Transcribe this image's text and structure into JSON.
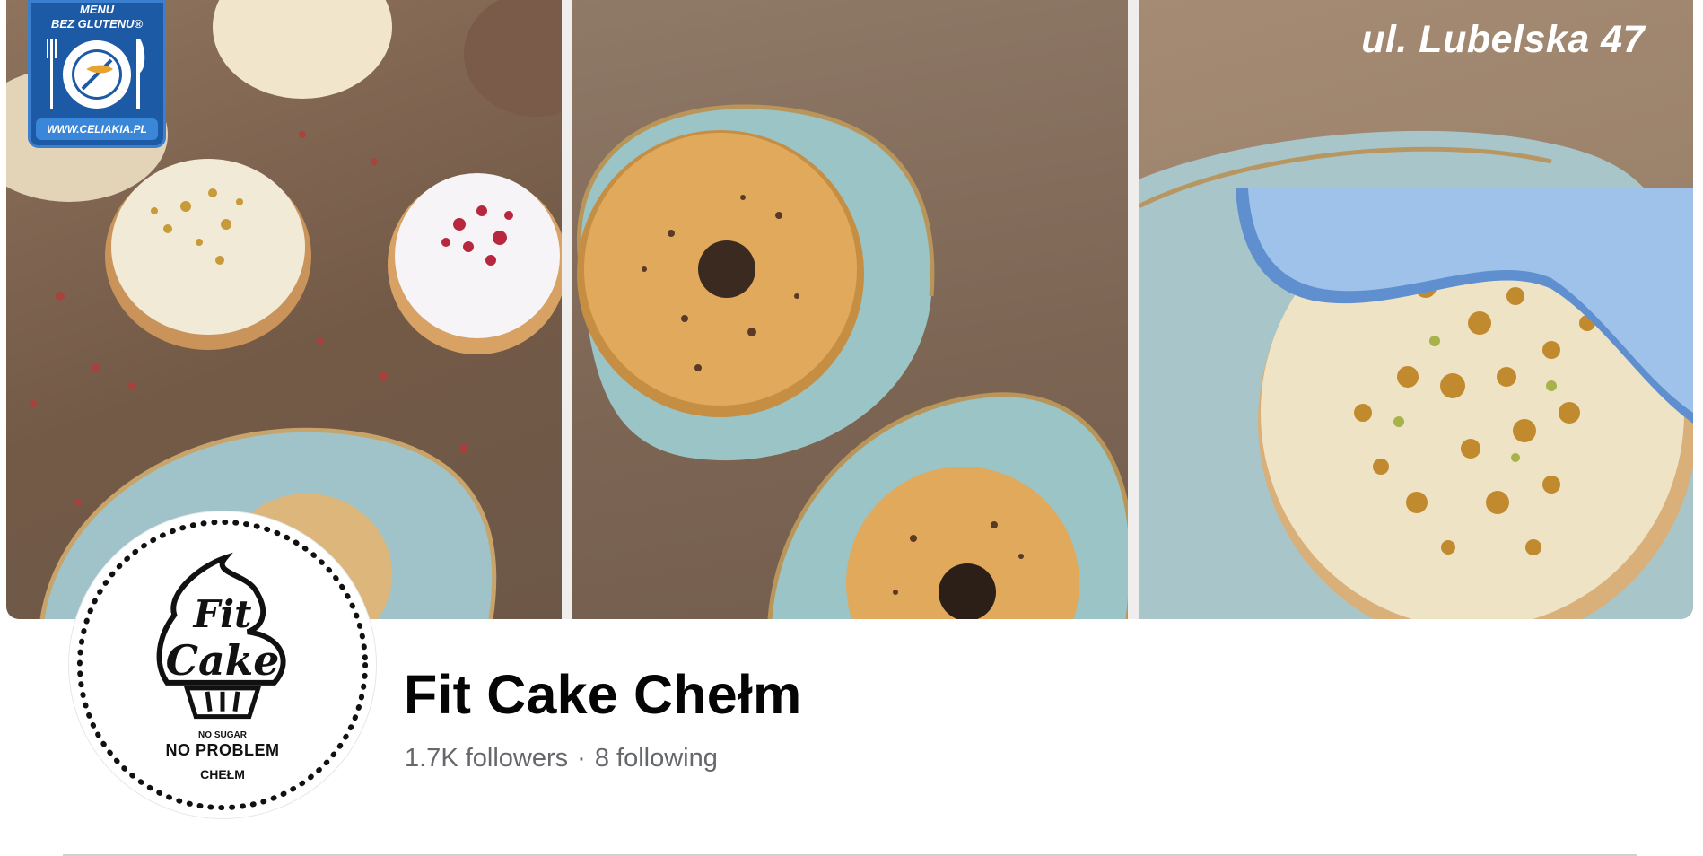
{
  "cover": {
    "badge": {
      "line1": "MENU",
      "line2": "BEZ GLUTENU®",
      "url": "WWW.CELIAKIA.PL"
    },
    "address": "ul. Lubelska 47"
  },
  "profile": {
    "avatar": {
      "logo_line1": "Fit",
      "logo_line2": "Cake",
      "sub": "NO SUGAR",
      "main": "NO PROBLEM",
      "city": "CHEŁM"
    },
    "name": "Fit Cake Chełm",
    "followers": "1.7K followers",
    "separator": "·",
    "following": "8 following"
  },
  "colors": {
    "badge_blue": "#1d5aa6",
    "banner_blue": "#8fb6e4",
    "text_primary": "#050505",
    "text_secondary": "#65676b",
    "divider": "#ced0d4"
  }
}
